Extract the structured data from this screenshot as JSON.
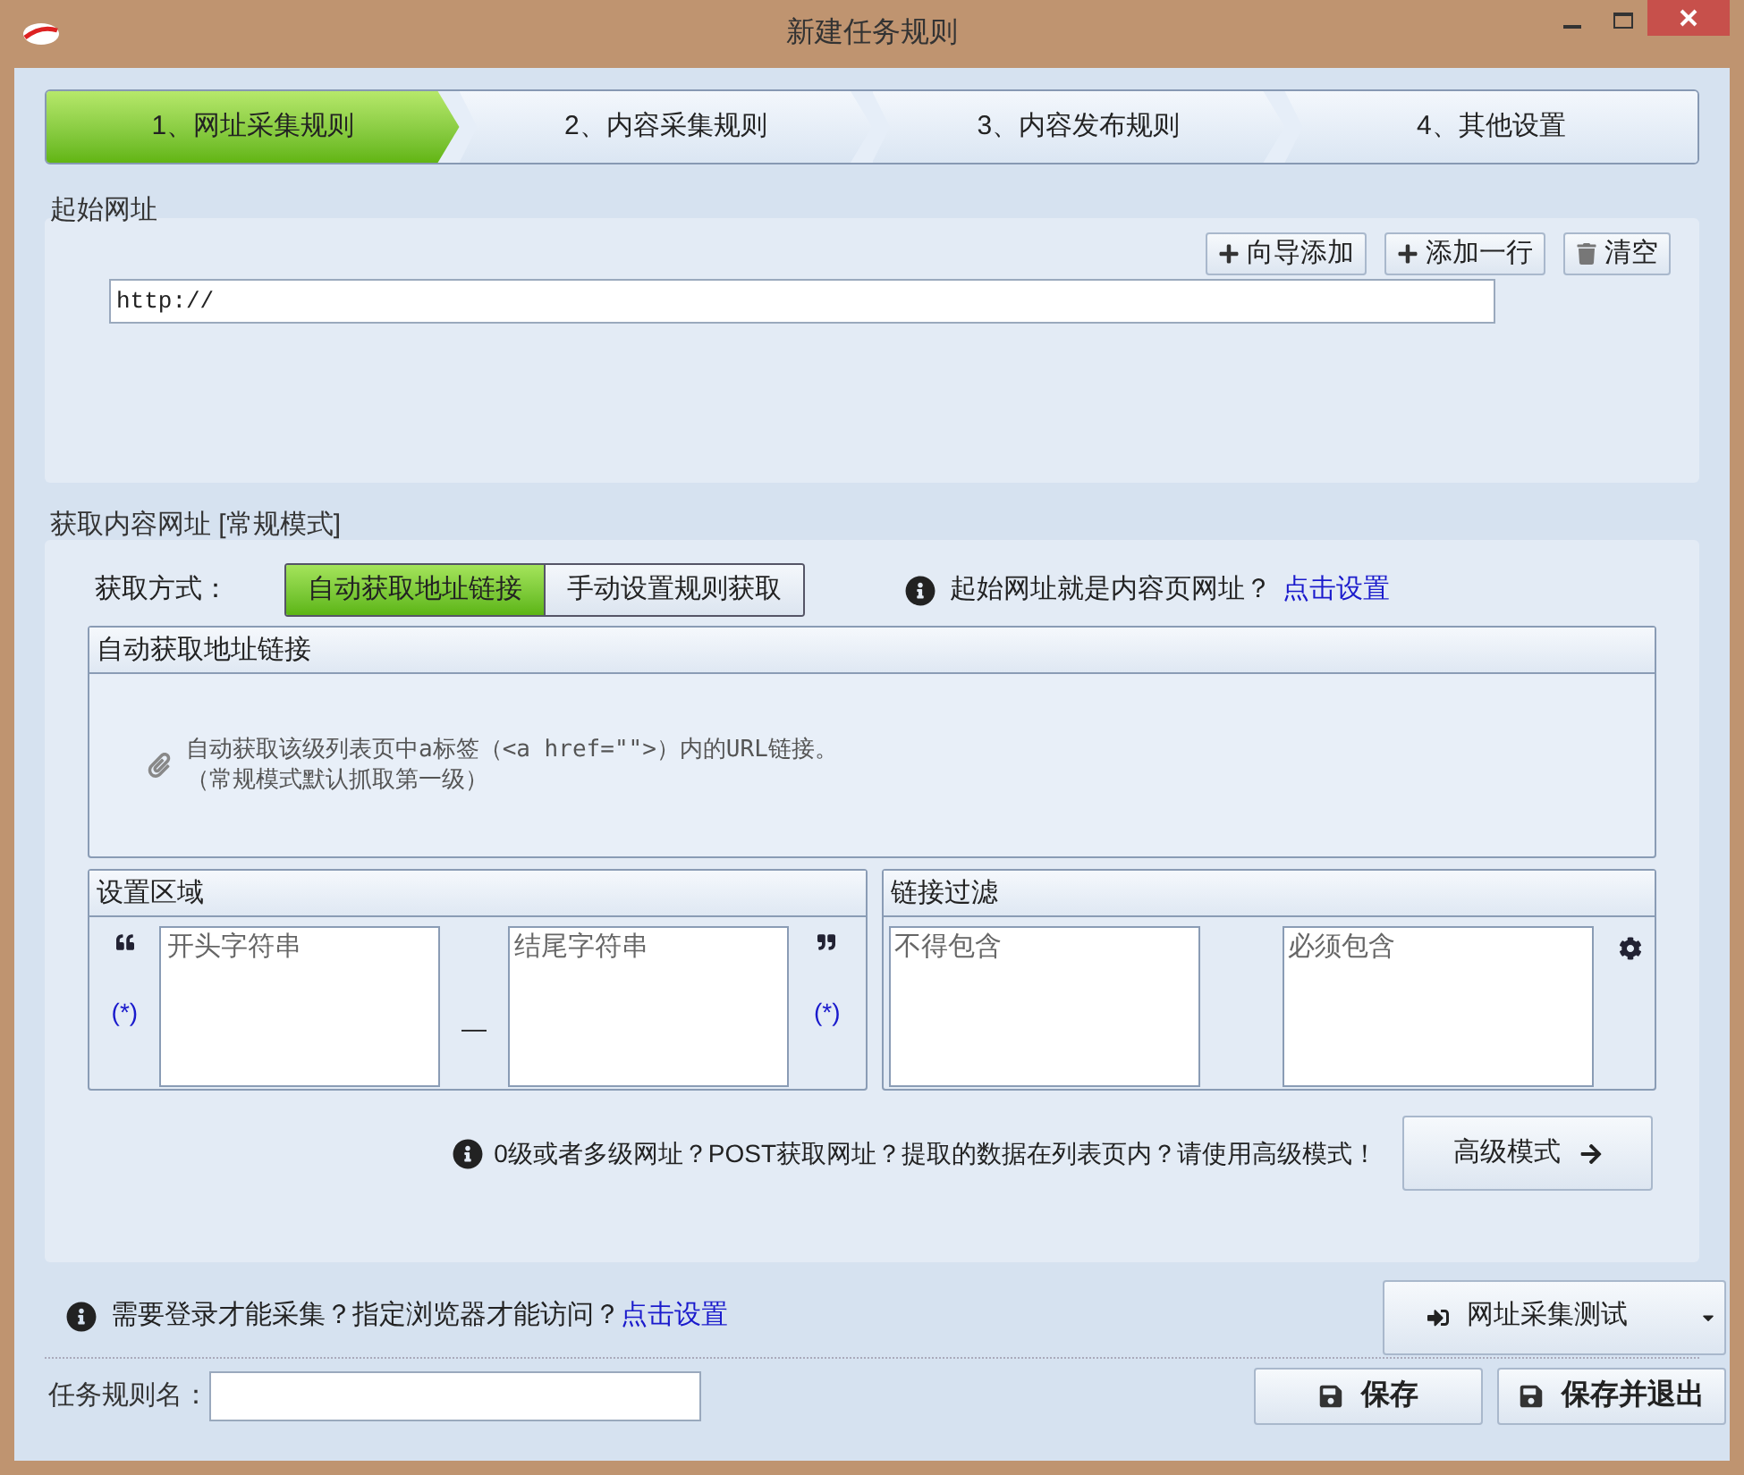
{
  "window": {
    "title": "新建任务规则"
  },
  "steps": [
    {
      "label": "1、网址采集规则",
      "selected": true
    },
    {
      "label": "2、内容采集规则",
      "selected": false
    },
    {
      "label": "3、内容发布规则",
      "selected": false
    },
    {
      "label": "4、其他设置",
      "selected": false
    }
  ],
  "start_url": {
    "title": "起始网址",
    "buttons": [
      "向导添加",
      "添加一行",
      "清空"
    ],
    "value": "http://"
  },
  "content_url": {
    "title": "获取内容网址 [常规模式]",
    "method_label": "获取方式：",
    "methods": [
      {
        "label": "自动获取地址链接",
        "selected": true
      },
      {
        "label": "手动设置规则获取",
        "selected": false
      }
    ],
    "hint": "起始网址就是内容页网址？",
    "hint_link": "点击设置",
    "auto_panel": {
      "title": "自动获取地址链接",
      "lines": [
        "自动获取该级列表页中a标签（<a href=\"\">）内的URL链接。",
        "（常规模式默认抓取第一级）"
      ]
    },
    "region": {
      "title": "设置区域",
      "start_placeholder": "开头字符串",
      "end_placeholder": "结尾字符串",
      "wildcards": [
        "(*)",
        "(*)"
      ],
      "dash": "—"
    },
    "filter": {
      "title": "链接过滤",
      "exclude_placeholder": "不得包含",
      "include_placeholder": "必须包含"
    },
    "advanced_hint": "0级或者多级网址？POST获取网址？提取的数据在列表页内？请使用高级模式！",
    "advanced_button": "高级模式"
  },
  "login_hint": "需要登录才能采集？指定浏览器才能访问？",
  "login_link": "点击设置",
  "test_button": "网址采集测试",
  "name_label": "任务规则名：",
  "save_buttons": [
    "保存",
    "保存并退出"
  ]
}
